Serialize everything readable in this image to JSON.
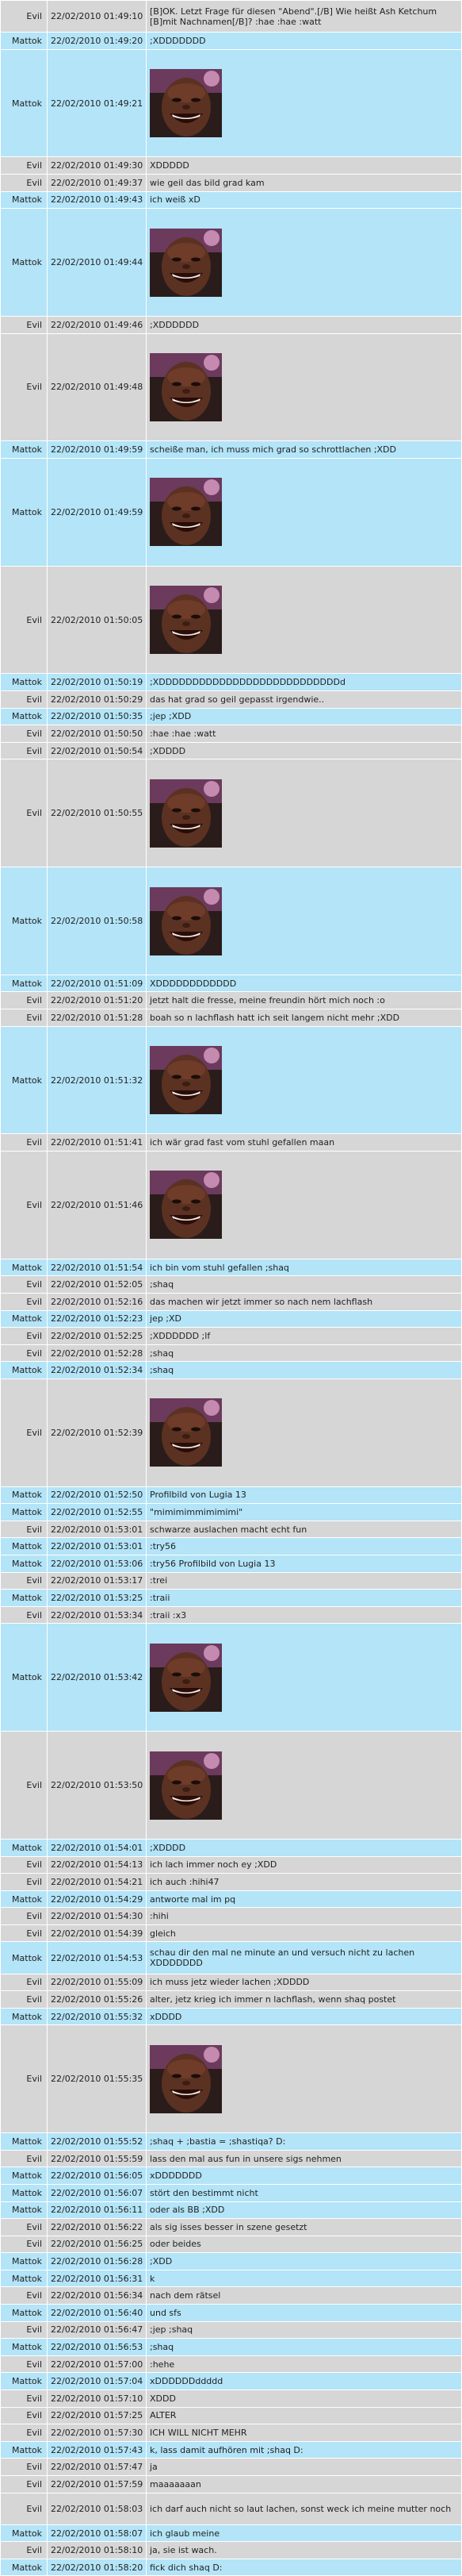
{
  "messages": [
    {
      "user": "Evil",
      "time": "22/02/2010 01:49:10",
      "text": "[B]OK. Letzt Frage für diesen \"Abend\".[/B] Wie heißt Ash Ketchum [B]mit Nachnamen[/B]? :hae :hae :watt",
      "h": 26
    },
    {
      "user": "Mattok",
      "time": "22/02/2010 01:49:20",
      "text": ";XDDDDDDD",
      "h": 14
    },
    {
      "user": "Mattok",
      "time": "22/02/2010 01:49:21",
      "image": "shaq-laughing-face",
      "h": 88
    },
    {
      "user": "Evil",
      "time": "22/02/2010 01:49:30",
      "text": "XDDDDD",
      "h": 14
    },
    {
      "user": "Evil",
      "time": "22/02/2010 01:49:37",
      "text": "wie geil das bild grad kam",
      "h": 14
    },
    {
      "user": "Mattok",
      "time": "22/02/2010 01:49:43",
      "text": "ich weiß xD",
      "h": 14
    },
    {
      "user": "Mattok",
      "time": "22/02/2010 01:49:44",
      "image": "shaq-laughing-face",
      "h": 88
    },
    {
      "user": "Evil",
      "time": "22/02/2010 01:49:46",
      "text": ";XDDDDDD",
      "h": 14
    },
    {
      "user": "Evil",
      "time": "22/02/2010 01:49:48",
      "image": "shaq-laughing-face",
      "h": 88
    },
    {
      "user": "Mattok",
      "time": "22/02/2010 01:49:59",
      "text": "scheiße man, ich muss mich grad so schrottlachen ;XDD",
      "h": 14
    },
    {
      "user": "Mattok",
      "time": "22/02/2010 01:49:59",
      "image": "shaq-laughing-face",
      "h": 88
    },
    {
      "user": "Evil",
      "time": "22/02/2010 01:50:05",
      "image": "shaq-laughing-face",
      "h": 88
    },
    {
      "user": "Mattok",
      "time": "22/02/2010 01:50:19",
      "text": ";XDDDDDDDDDDDDDDDDDDDDDDDDDDDd",
      "h": 14
    },
    {
      "user": "Evil",
      "time": "22/02/2010 01:50:29",
      "text": "das hat grad so geil gepasst irgendwie..",
      "h": 14
    },
    {
      "user": "Mattok",
      "time": "22/02/2010 01:50:35",
      "text": ";jep ;XDD",
      "h": 14
    },
    {
      "user": "Evil",
      "time": "22/02/2010 01:50:50",
      "text": ":hae :hae :watt",
      "h": 14
    },
    {
      "user": "Evil",
      "time": "22/02/2010 01:50:54",
      "text": ";XDDDD",
      "h": 14
    },
    {
      "user": "Evil",
      "time": "22/02/2010 01:50:55",
      "image": "shaq-laughing-face",
      "h": 88
    },
    {
      "user": "Mattok",
      "time": "22/02/2010 01:50:58",
      "image": "shaq-laughing-face",
      "h": 88
    },
    {
      "user": "Mattok",
      "time": "22/02/2010 01:51:09",
      "text": "XDDDDDDDDDDDD",
      "h": 14
    },
    {
      "user": "Evil",
      "time": "22/02/2010 01:51:20",
      "text": "jetzt halt die fresse, meine freundin hört mich noch :o",
      "h": 14
    },
    {
      "user": "Evil",
      "time": "22/02/2010 01:51:28",
      "text": "boah so n lachflash hatt ich seit langem nicht mehr ;XDD",
      "h": 14
    },
    {
      "user": "Mattok",
      "time": "22/02/2010 01:51:32",
      "image": "shaq-laughing-face",
      "h": 88
    },
    {
      "user": "Evil",
      "time": "22/02/2010 01:51:41",
      "text": "ich wär grad fast vom stuhl gefallen maan",
      "h": 14
    },
    {
      "user": "Evil",
      "time": "22/02/2010 01:51:46",
      "image": "shaq-laughing-face",
      "h": 88
    },
    {
      "user": "Mattok",
      "time": "22/02/2010 01:51:54",
      "text": "ich bin vom stuhl gefallen ;shaq",
      "h": 14
    },
    {
      "user": "Evil",
      "time": "22/02/2010 01:52:05",
      "text": ";shaq",
      "h": 14
    },
    {
      "user": "Evil",
      "time": "22/02/2010 01:52:16",
      "text": "das machen wir jetzt immer so nach nem lachflash",
      "h": 14
    },
    {
      "user": "Mattok",
      "time": "22/02/2010 01:52:23",
      "text": "jep ;XD",
      "h": 14
    },
    {
      "user": "Evil",
      "time": "22/02/2010 01:52:25",
      "text": ";XDDDDDD ;lf",
      "h": 14
    },
    {
      "user": "Evil",
      "time": "22/02/2010 01:52:28",
      "text": ";shaq",
      "h": 14
    },
    {
      "user": "Mattok",
      "time": "22/02/2010 01:52:34",
      "text": ";shaq",
      "h": 14
    },
    {
      "user": "Evil",
      "time": "22/02/2010 01:52:39",
      "image": "shaq-laughing-face",
      "h": 88
    },
    {
      "user": "Mattok",
      "time": "22/02/2010 01:52:50",
      "text": "Profilbild von Lugia 13",
      "h": 14
    },
    {
      "user": "Mattok",
      "time": "22/02/2010 01:52:55",
      "text": "\"mimimimmimimimi\"",
      "h": 14
    },
    {
      "user": "Evil",
      "time": "22/02/2010 01:53:01",
      "text": "schwarze auslachen macht echt fun",
      "h": 14
    },
    {
      "user": "Mattok",
      "time": "22/02/2010 01:53:01",
      "text": ":try56",
      "h": 14
    },
    {
      "user": "Mattok",
      "time": "22/02/2010 01:53:06",
      "text": ":try56 Profilbild von Lugia 13",
      "h": 14
    },
    {
      "user": "Evil",
      "time": "22/02/2010 01:53:17",
      "text": ":trei",
      "h": 14
    },
    {
      "user": "Mattok",
      "time": "22/02/2010 01:53:25",
      "text": ":traii",
      "h": 14
    },
    {
      "user": "Evil",
      "time": "22/02/2010 01:53:34",
      "text": ":traii :x3",
      "h": 14
    },
    {
      "user": "Mattok",
      "time": "22/02/2010 01:53:42",
      "image": "shaq-laughing-face",
      "h": 88
    },
    {
      "user": "Evil",
      "time": "22/02/2010 01:53:50",
      "image": "shaq-laughing-face",
      "h": 88
    },
    {
      "user": "Mattok",
      "time": "22/02/2010 01:54:01",
      "text": ";XDDDD",
      "h": 14
    },
    {
      "user": "Evil",
      "time": "22/02/2010 01:54:13",
      "text": "ich lach immer noch ey ;XDD",
      "h": 14
    },
    {
      "user": "Evil",
      "time": "22/02/2010 01:54:21",
      "text": "ich auch :hihi47",
      "h": 14
    },
    {
      "user": "Mattok",
      "time": "22/02/2010 01:54:29",
      "text": "antworte mal im pq",
      "h": 14
    },
    {
      "user": "Evil",
      "time": "22/02/2010 01:54:30",
      "text": ":hihi",
      "h": 14
    },
    {
      "user": "Evil",
      "time": "22/02/2010 01:54:39",
      "text": "gleich",
      "h": 14
    },
    {
      "user": "Mattok",
      "time": "22/02/2010 01:54:53",
      "text": "schau dir den mal ne minute an und versuch nicht zu lachen XDDDDDDD",
      "h": 26
    },
    {
      "user": "Evil",
      "time": "22/02/2010 01:55:09",
      "text": "ich muss jetz wieder lachen ;XDDDD",
      "h": 14
    },
    {
      "user": "Evil",
      "time": "22/02/2010 01:55:26",
      "text": "alter, jetz krieg ich immer n lachflash, wenn shaq postet",
      "h": 14
    },
    {
      "user": "Mattok",
      "time": "22/02/2010 01:55:32",
      "text": "xDDDD",
      "h": 14
    },
    {
      "user": "Evil",
      "time": "22/02/2010 01:55:35",
      "image": "shaq-laughing-face",
      "h": 88
    },
    {
      "user": "Mattok",
      "time": "22/02/2010 01:55:52",
      "text": ";shaq + ;bastia = ;shastiqa? D:",
      "h": 14
    },
    {
      "user": "Evil",
      "time": "22/02/2010 01:55:59",
      "text": "lass den mal aus fun in unsere sigs nehmen",
      "h": 14
    },
    {
      "user": "Mattok",
      "time": "22/02/2010 01:56:05",
      "text": "xDDDDDDD",
      "h": 14
    },
    {
      "user": "Mattok",
      "time": "22/02/2010 01:56:07",
      "text": "stört den bestimmt nicht",
      "h": 14
    },
    {
      "user": "Mattok",
      "time": "22/02/2010 01:56:11",
      "text": "oder als BB ;XDD",
      "h": 14
    },
    {
      "user": "Evil",
      "time": "22/02/2010 01:56:22",
      "text": "als sig isses besser in szene gesetzt",
      "h": 14
    },
    {
      "user": "Evil",
      "time": "22/02/2010 01:56:25",
      "text": "oder beides",
      "h": 14
    },
    {
      "user": "Mattok",
      "time": "22/02/2010 01:56:28",
      "text": ";XDD",
      "h": 14
    },
    {
      "user": "Mattok",
      "time": "22/02/2010 01:56:31",
      "text": "k",
      "h": 14
    },
    {
      "user": "Evil",
      "time": "22/02/2010 01:56:34",
      "text": "nach dem rätsel",
      "h": 14
    },
    {
      "user": "Mattok",
      "time": "22/02/2010 01:56:40",
      "text": "und sfs",
      "h": 14
    },
    {
      "user": "Evil",
      "time": "22/02/2010 01:56:47",
      "text": ";jep ;shaq",
      "h": 14
    },
    {
      "user": "Mattok",
      "time": "22/02/2010 01:56:53",
      "text": ";shaq",
      "h": 14
    },
    {
      "user": "Evil",
      "time": "22/02/2010 01:57:00",
      "text": ":hehe",
      "h": 14
    },
    {
      "user": "Mattok",
      "time": "22/02/2010 01:57:04",
      "text": "xDDDDDDddddd",
      "h": 14
    },
    {
      "user": "Evil",
      "time": "22/02/2010 01:57:10",
      "text": "XDDD",
      "h": 14
    },
    {
      "user": "Evil",
      "time": "22/02/2010 01:57:25",
      "text": "ALTER",
      "h": 14
    },
    {
      "user": "Evil",
      "time": "22/02/2010 01:57:30",
      "text": "ICH WILL NICHT MEHR",
      "h": 14
    },
    {
      "user": "Mattok",
      "time": "22/02/2010 01:57:43",
      "text": "k, lass damit aufhören mit ;shaq D:",
      "h": 14
    },
    {
      "user": "Evil",
      "time": "22/02/2010 01:57:47",
      "text": "ja",
      "h": 14
    },
    {
      "user": "Evil",
      "time": "22/02/2010 01:57:59",
      "text": "maaaaaaan",
      "h": 14
    },
    {
      "user": "Evil",
      "time": "22/02/2010 01:58:03",
      "text": "ich darf auch nicht so laut lachen, sonst weck ich meine mutter noch",
      "h": 26
    },
    {
      "user": "Mattok",
      "time": "22/02/2010 01:58:07",
      "text": "ich glaub meine",
      "h": 14
    },
    {
      "user": "Evil",
      "time": "22/02/2010 01:58:10",
      "text": "ja, sie ist wach.",
      "h": 14
    },
    {
      "user": "Mattok",
      "time": "22/02/2010 01:58:20",
      "text": "fick dich shaq D:",
      "h": 14
    }
  ]
}
